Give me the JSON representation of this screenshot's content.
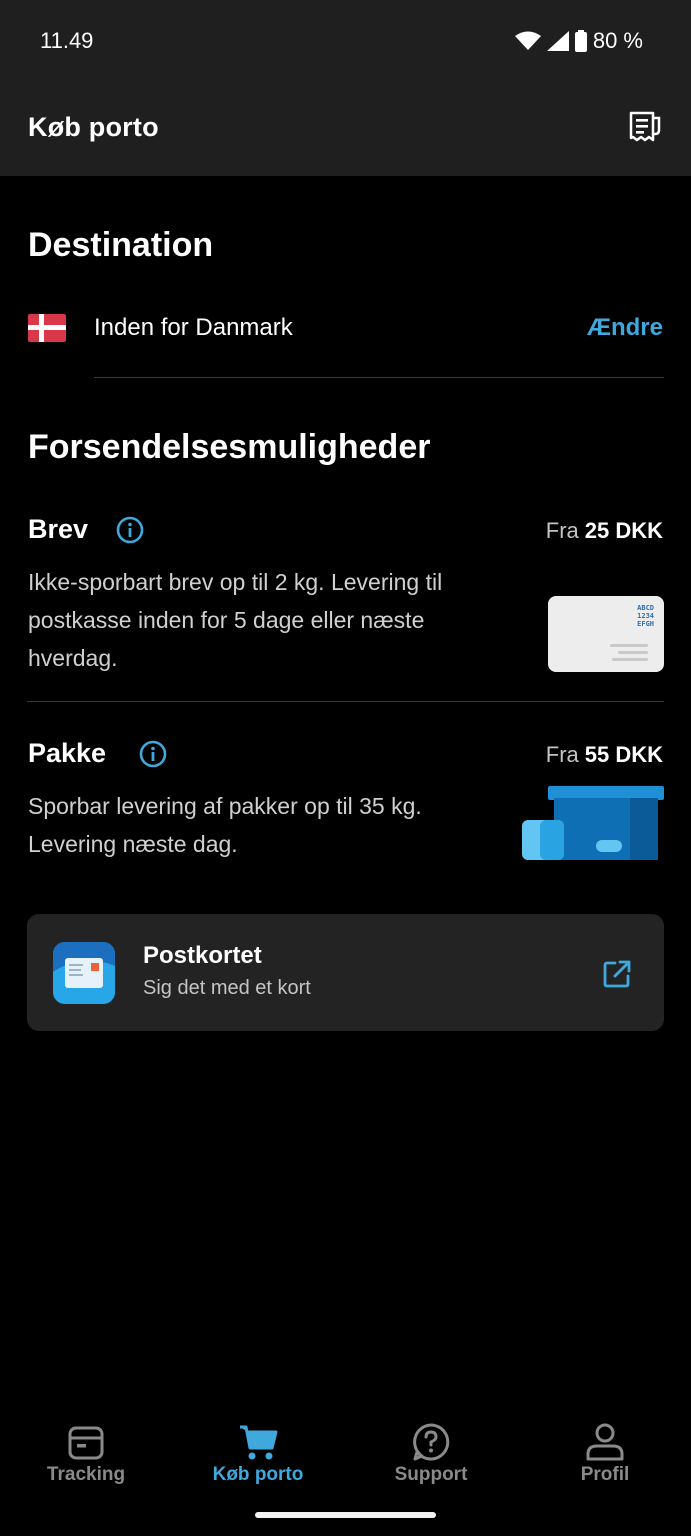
{
  "status_bar": {
    "time": "11.49",
    "battery": "80 %"
  },
  "header": {
    "title": "Køb porto"
  },
  "destination": {
    "heading": "Destination",
    "country": "Inden for Danmark",
    "change_label": "Ændre"
  },
  "options": {
    "heading": "Forsendelsesmuligheder",
    "items": [
      {
        "name": "Brev",
        "price_prefix": "Fra",
        "price": "25 DKK",
        "desc_lines": [
          "Ikke-sporbart brev op til 2 kg. Levering til",
          "postkasse inden for 5 dage eller næste",
          "hverdag."
        ],
        "image_text": [
          "ABCD",
          "1234",
          "EFGH"
        ]
      },
      {
        "name": "Pakke",
        "price_prefix": "Fra",
        "price": "55 DKK",
        "desc_lines": [
          "Sporbar levering af pakker op til 35 kg.",
          "Levering næste dag."
        ]
      }
    ]
  },
  "postcard": {
    "title": "Postkortet",
    "subtitle": "Sig det med et kort"
  },
  "nav": {
    "items": [
      {
        "label": "Tracking",
        "icon": "package-icon",
        "active": false
      },
      {
        "label": "Køb porto",
        "icon": "cart-icon",
        "active": true
      },
      {
        "label": "Support",
        "icon": "question-icon",
        "active": false
      },
      {
        "label": "Profil",
        "icon": "user-icon",
        "active": false
      }
    ]
  },
  "colors": {
    "accent": "#3fa9de",
    "background": "#000000",
    "header": "#1f1f1f",
    "card": "#232323"
  }
}
